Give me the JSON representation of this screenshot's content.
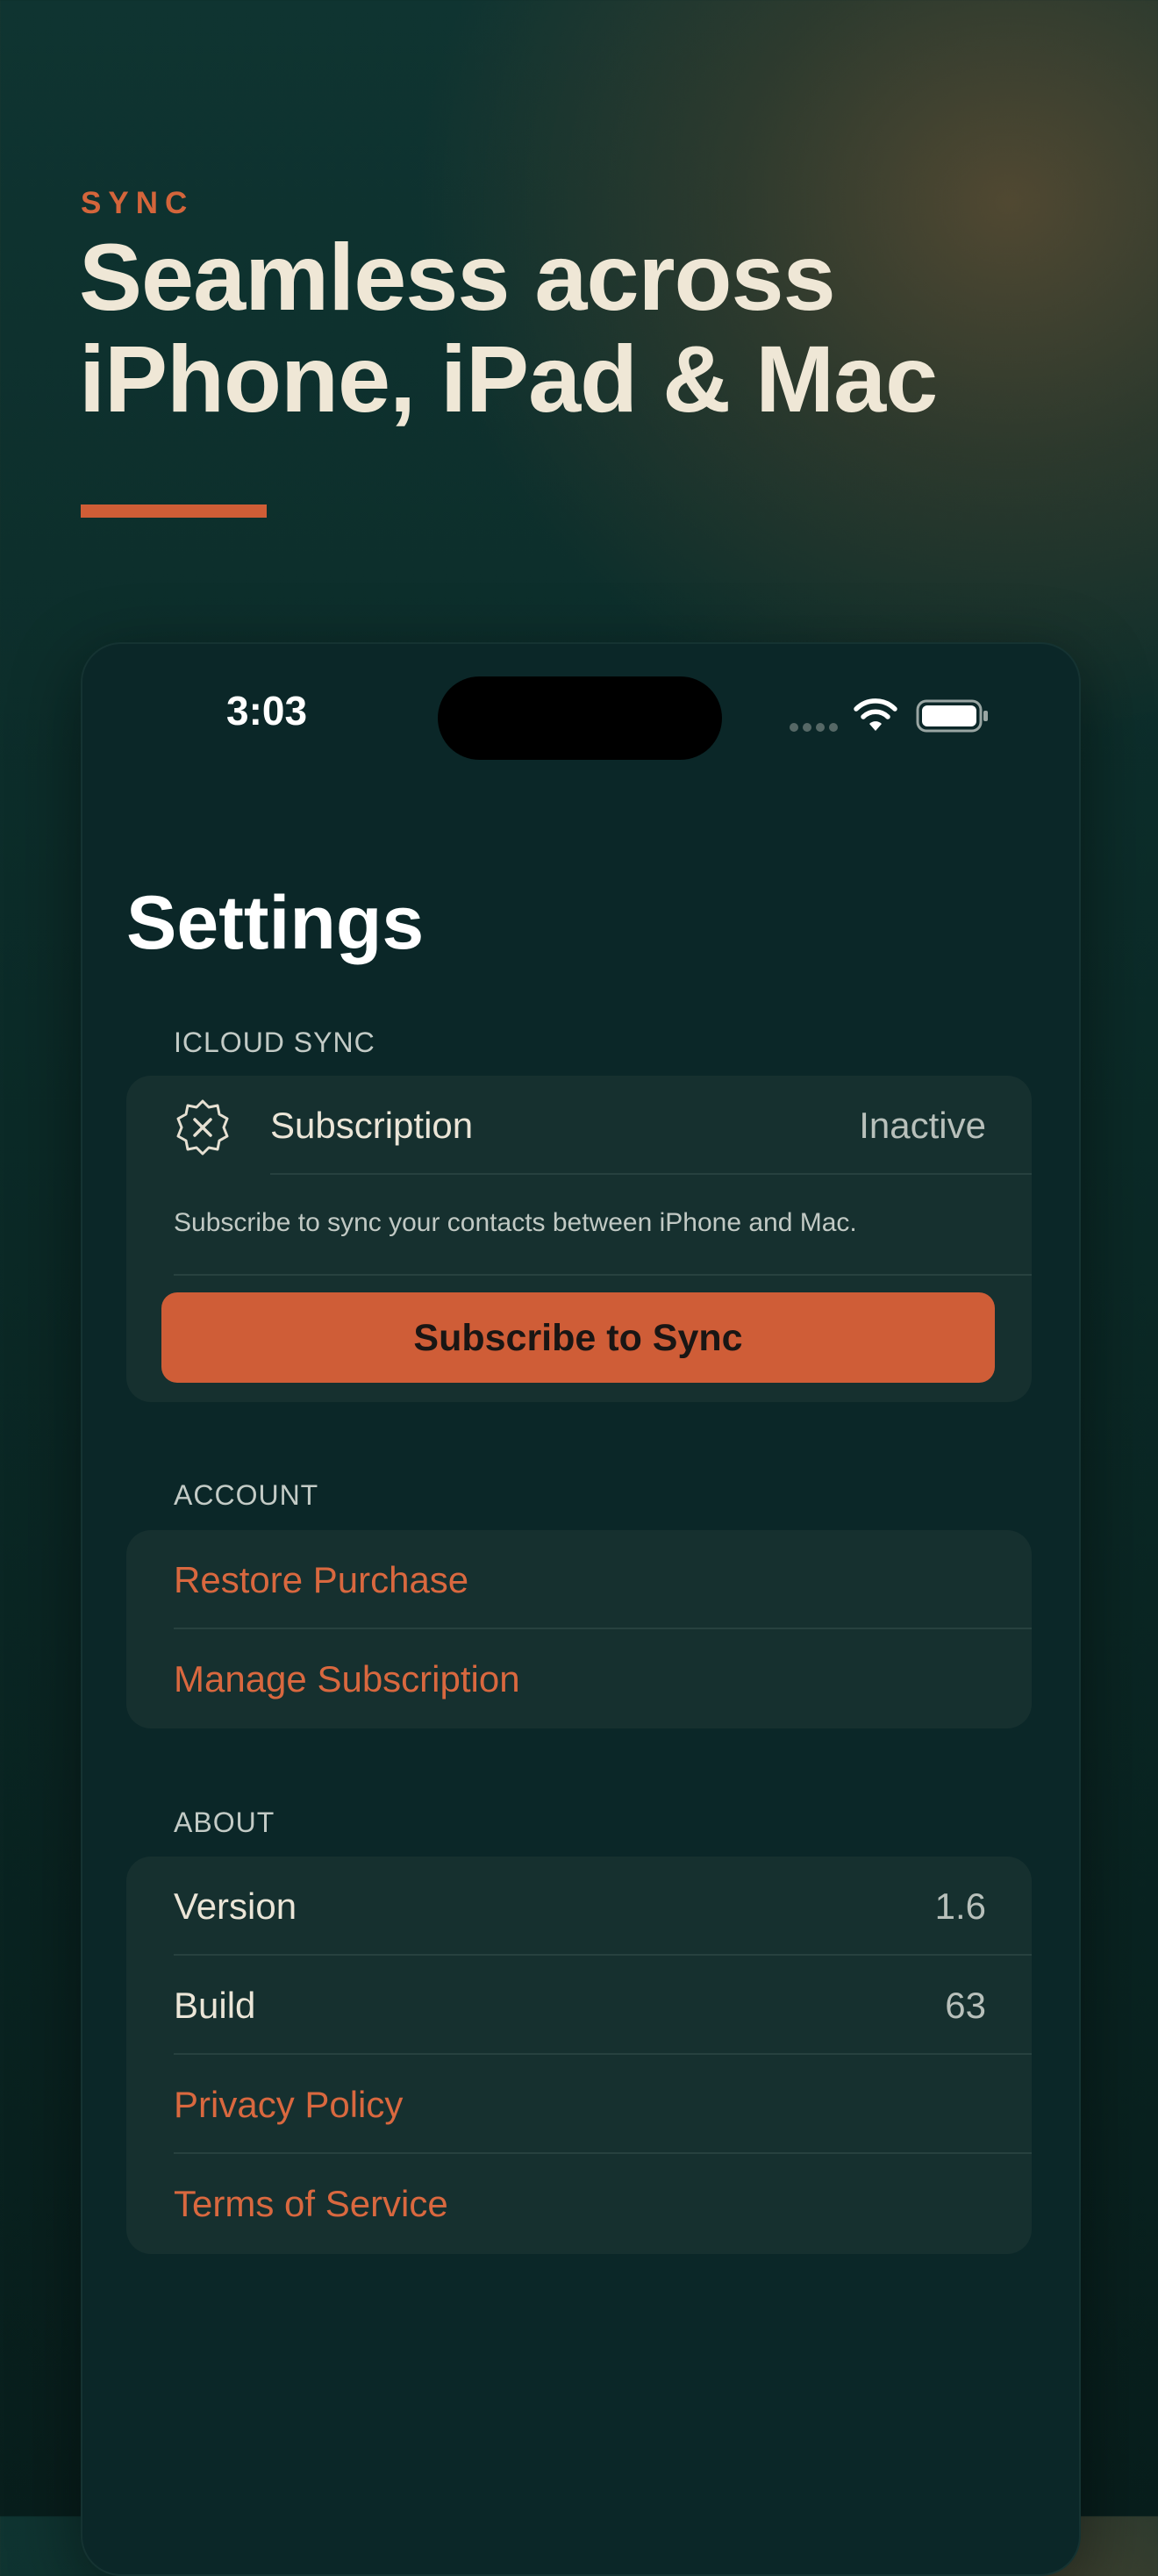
{
  "hero": {
    "eyebrow": "SYNC",
    "title_line1": "Seamless across",
    "title_line2": "iPhone, iPad & Mac",
    "accent_color": "#d4653b"
  },
  "status_bar": {
    "time": "3:03",
    "icons": [
      "cellular-signal-icon",
      "wifi-icon",
      "battery-icon"
    ]
  },
  "settings": {
    "title": "Settings",
    "sections": {
      "icloud_sync": {
        "header": "ICLOUD SYNC",
        "subscription_label": "Subscription",
        "subscription_value": "Inactive",
        "subscription_icon": "badge-x-icon",
        "description": "Subscribe to sync your contacts between iPhone and Mac.",
        "button_label": "Subscribe to Sync"
      },
      "account": {
        "header": "ACCOUNT",
        "restore_label": "Restore Purchase",
        "manage_label": "Manage Subscription"
      },
      "about": {
        "header": "ABOUT",
        "version_label": "Version",
        "version_value": "1.6",
        "build_label": "Build",
        "build_value": "63",
        "privacy_label": "Privacy Policy",
        "terms_label": "Terms of Service"
      }
    }
  },
  "colors": {
    "background": "#0b2422",
    "card": "#16302f",
    "accent": "#cf5d37",
    "link": "#d9683f",
    "text_primary": "#ebe5d7",
    "text_secondary": "#b8c0bb"
  }
}
